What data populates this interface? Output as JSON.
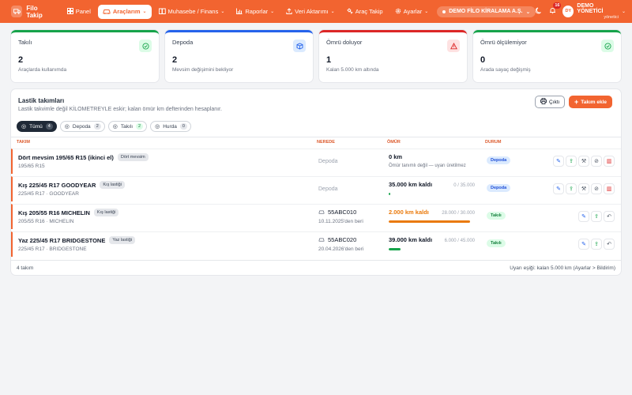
{
  "nav": {
    "brand": "Filo Takip",
    "items": [
      {
        "label": "Panel",
        "icon": "grid-icon",
        "active": false,
        "dropdown": false
      },
      {
        "label": "Araçlarım",
        "icon": "car-icon",
        "active": true,
        "dropdown": true
      },
      {
        "label": "Muhasebe / Finans",
        "icon": "book-icon",
        "active": false,
        "dropdown": true
      },
      {
        "label": "Raporlar",
        "icon": "bar-chart-icon",
        "active": false,
        "dropdown": true
      },
      {
        "label": "Veri Aktarımı",
        "icon": "upload-icon",
        "active": false,
        "dropdown": true
      },
      {
        "label": "Araç Takip",
        "icon": "satellite-icon",
        "active": false,
        "dropdown": false
      },
      {
        "label": "Ayarlar",
        "icon": "gear-icon",
        "active": false,
        "dropdown": true
      }
    ],
    "company": "DEMO FİLO KİRALAMA A.Ş.",
    "notification_count": "16",
    "user_initials": "DY",
    "user_name": "DEMO YÖNETİCİ",
    "user_role": "yönetici"
  },
  "stats": [
    {
      "label": "Takılı",
      "value": "2",
      "sub": "Araçlarda kullanımda",
      "accent": "#16a34a",
      "icon": "check-circle-icon"
    },
    {
      "label": "Depoda",
      "value": "2",
      "sub": "Mevsim değişimini bekliyor",
      "accent": "#2563eb",
      "icon": "box-icon"
    },
    {
      "label": "Ömrü doluyor",
      "value": "1",
      "sub": "Kalan 5.000 km altında",
      "accent": "#dc2626",
      "icon": "warning-icon"
    },
    {
      "label": "Ömrü ölçülemiyor",
      "value": "0",
      "sub": "Arada sayaç değişmiş",
      "accent": "#16a34a",
      "icon": "check-circle-icon"
    }
  ],
  "panel": {
    "title": "Lastik takımları",
    "description": "Lastik takvimle değil KİLOMETREYLE eskir; kalan ömür km defterinden hesaplanır.",
    "export_label": "Çıktı",
    "add_label": "Takım ekle",
    "filters": [
      {
        "label": "Tümü",
        "count": "4",
        "active": true
      },
      {
        "label": "Depoda",
        "count": "2",
        "active": false
      },
      {
        "label": "Takılı",
        "count": "2",
        "active": false
      },
      {
        "label": "Hurda",
        "count": "0",
        "active": false
      }
    ],
    "columns": {
      "name": "TAKIM",
      "where": "NEREDE",
      "life": "ÖMÜR",
      "status": "DURUM"
    },
    "rows": [
      {
        "name": "Dört mevsim 195/65 R15 (ikinci el)",
        "tag": "Dört mevsim",
        "sub": "195/65 R15",
        "where": "Depoda",
        "plate": "",
        "date": "",
        "life": "0 km",
        "life_note": "Ömür tanımlı değil — uyarı üretilmez",
        "ratio": "",
        "progress": 0,
        "status": "Depoda"
      },
      {
        "name": "Kış 225/45 R17 GOODYEAR",
        "tag": "Kış lastiği",
        "sub": "225/45 R17 · GOODYEAR",
        "where": "Depoda",
        "plate": "",
        "date": "",
        "life": "35.000 km kaldı",
        "life_note": "",
        "ratio": "0 / 35.000",
        "progress": 0.02,
        "status": "Depoda"
      },
      {
        "name": "Kış 205/55 R16 MICHELIN",
        "tag": "Kış lastiği",
        "sub": "205/55 R16 · MICHELIN",
        "where": "",
        "plate": "55ABC010",
        "date": "10.11.2025'den beri",
        "life": "2.000 km kaldı",
        "life_note": "",
        "ratio": "28.000 / 30.000",
        "progress": 0.933,
        "status": "Takılı"
      },
      {
        "name": "Yaz 225/45 R17 BRIDGESTONE",
        "tag": "Yaz lastiği",
        "sub": "225/45 R17 · BRIDGESTONE",
        "where": "",
        "plate": "55ABC020",
        "date": "20.04.2026'den beri",
        "life": "39.000 km kaldı",
        "life_note": "",
        "ratio": "6.000 / 45.000",
        "progress": 0.133,
        "status": "Takılı"
      }
    ],
    "footer_count": "4 takım",
    "footer_note": "Uyarı eşiği: kalan 5.000 km (Ayarlar > Bildirim)"
  }
}
